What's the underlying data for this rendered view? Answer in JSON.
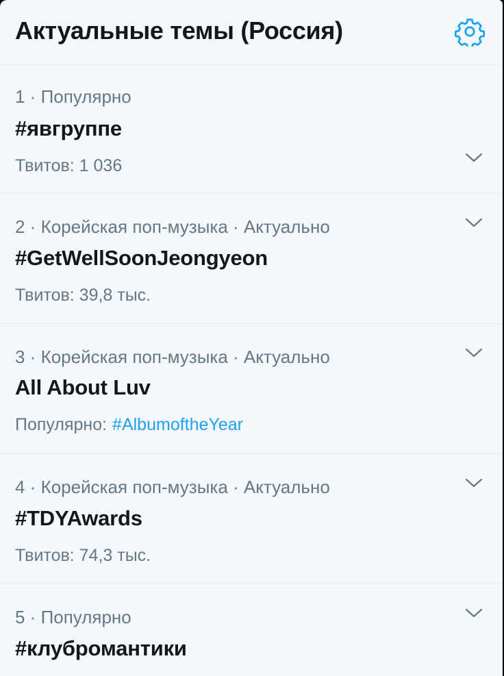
{
  "header": {
    "title": "Актуальные темы (Россия)",
    "settings_icon": "gear-icon",
    "accent_color": "#1da1f2"
  },
  "trends": [
    {
      "meta": "1 · Популярно",
      "name": "#явгруппе",
      "sub": "Твитов: 1 036"
    },
    {
      "meta": "2 · Корейская поп-музыка · Актуально",
      "name": "#GetWellSoonJeongyeon",
      "sub": "Твитов: 39,8 тыс."
    },
    {
      "meta": "3 · Корейская поп-музыка · Актуально",
      "name": "All About Luv",
      "sub_label": "Популярно:",
      "sub_link": "#AlbumoftheYear"
    },
    {
      "meta": "4 · Корейская поп-музыка · Актуально",
      "name": "#TDYAwards",
      "sub": "Твитов: 74,3 тыс."
    },
    {
      "meta": "5 · Популярно",
      "name": "#клубромантики"
    }
  ],
  "icons": {
    "chevron": "chevron-down-icon"
  }
}
